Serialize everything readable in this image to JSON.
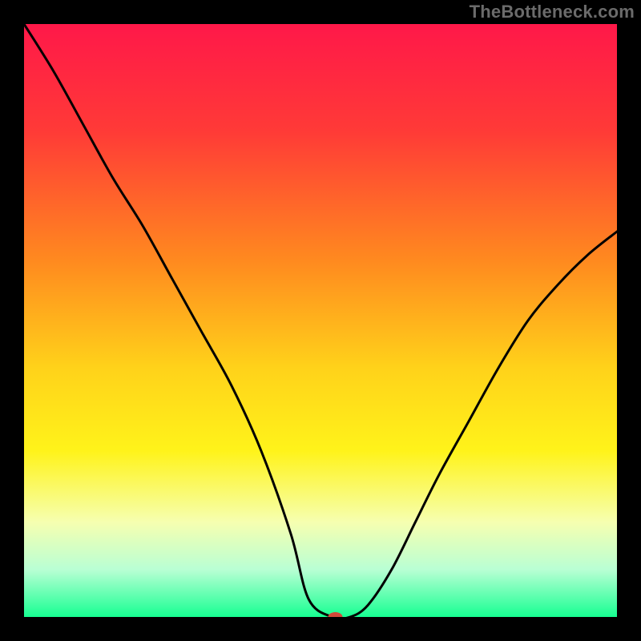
{
  "watermark": "TheBottleneck.com",
  "chart_data": {
    "type": "line",
    "title": "",
    "xlabel": "",
    "ylabel": "",
    "xlim": [
      0,
      100
    ],
    "ylim": [
      0,
      100
    ],
    "grid": false,
    "legend": false,
    "gradient_stops": [
      {
        "t": 0.0,
        "color": "#ff1849"
      },
      {
        "t": 0.18,
        "color": "#ff3a37"
      },
      {
        "t": 0.4,
        "color": "#ff8a1f"
      },
      {
        "t": 0.58,
        "color": "#ffd21a"
      },
      {
        "t": 0.72,
        "color": "#fff31a"
      },
      {
        "t": 0.84,
        "color": "#f6ffb0"
      },
      {
        "t": 0.92,
        "color": "#b9ffd4"
      },
      {
        "t": 1.0,
        "color": "#17ff92"
      }
    ],
    "series": [
      {
        "name": "bottleneck-curve",
        "x": [
          0,
          5,
          10,
          15,
          20,
          25,
          30,
          35,
          40,
          45,
          48,
          52,
          55,
          58,
          62,
          66,
          70,
          75,
          80,
          85,
          90,
          95,
          100
        ],
        "y": [
          100,
          92,
          83,
          74,
          66,
          57,
          48,
          39,
          28,
          14,
          3,
          0,
          0,
          2,
          8,
          16,
          24,
          33,
          42,
          50,
          56,
          61,
          65
        ]
      }
    ],
    "marker": {
      "x": 52.5,
      "y": 0,
      "color": "#d24a3a",
      "rx": 9,
      "ry": 6
    }
  }
}
